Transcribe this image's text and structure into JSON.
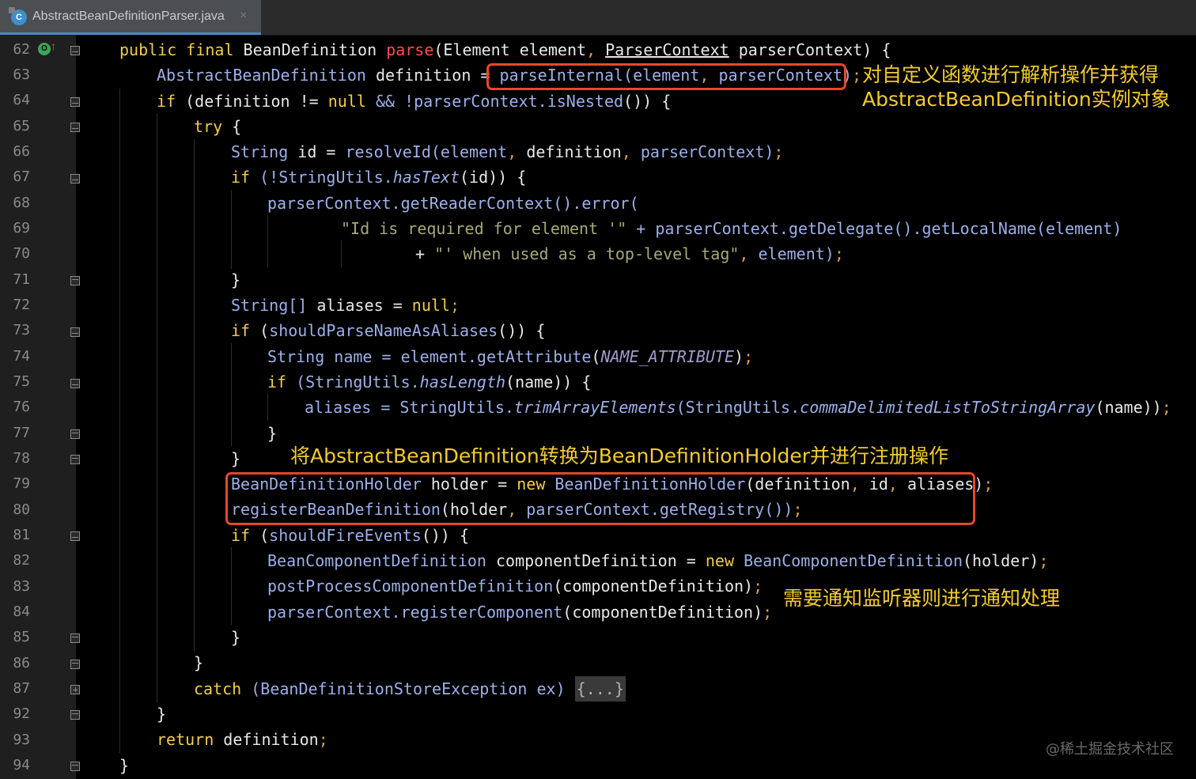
{
  "tab": {
    "title": "AbstractBeanDefinitionParser.java",
    "icon_letter": "C",
    "close_glyph": "×"
  },
  "gutter": {
    "line_numbers": [
      "62",
      "63",
      "64",
      "65",
      "66",
      "67",
      "68",
      "69",
      "70",
      "71",
      "72",
      "73",
      "74",
      "75",
      "76",
      "77",
      "78",
      "79",
      "80",
      "81",
      "82",
      "83",
      "84",
      "85",
      "86",
      "87",
      "92",
      "93",
      "94"
    ],
    "override_letter": "O",
    "override_arrow": "↑"
  },
  "code": {
    "l62": [
      "public final ",
      "BeanDefinition ",
      "parse",
      "(Element element",
      ", ",
      "ParserContext",
      " parserContext) {"
    ],
    "l63": [
      "AbstractBeanDefinition ",
      "definition = ",
      "parseInternal(element",
      ", ",
      "parserContext)",
      ";"
    ],
    "l64": [
      "if ",
      "(definition != ",
      "null ",
      "&& !parserContext.",
      "isNested",
      "()) {"
    ],
    "l65": [
      "try ",
      "{"
    ],
    "l66": [
      "String ",
      "id = ",
      "resolveId",
      "(element",
      ", ",
      "definition",
      ", ",
      "parserContext)",
      ";"
    ],
    "l67": [
      "if ",
      "(!StringUtils.",
      "hasText",
      "(id)) {"
    ],
    "l68": [
      "parserContext.",
      "getReaderContext",
      "().",
      "error",
      "("
    ],
    "l69": [
      "\"Id is required for element '\" ",
      "+ parserContext.",
      "getDelegate",
      "().",
      "getLocalName",
      "(element)"
    ],
    "l70": [
      "+ ",
      "\"' when used as a top-level tag\"",
      ", ",
      "element)",
      ";"
    ],
    "l71": [
      "}"
    ],
    "l72": [
      "String[] ",
      "aliases = ",
      "null",
      ";"
    ],
    "l73": [
      "if ",
      "(",
      "shouldParseNameAsAliases",
      "()) {"
    ],
    "l74": [
      "String ",
      "name = element.",
      "getAttribute",
      "(",
      "NAME_ATTRIBUTE",
      ")",
      ";"
    ],
    "l75": [
      "if ",
      "(StringUtils.",
      "hasLength",
      "(name)) {"
    ],
    "l76": [
      "aliases = StringUtils.",
      "trimArrayElements",
      "(StringUtils.",
      "commaDelimitedListToStringArray",
      "(name))",
      ";"
    ],
    "l77": [
      "}"
    ],
    "l78": [
      "}"
    ],
    "l79": [
      "BeanDefinitionHolder ",
      "holder = ",
      "new ",
      "BeanDefinitionHolder",
      "(definition",
      ", ",
      "id",
      ", ",
      "aliases)",
      ";"
    ],
    "l80": [
      "registerBeanDefinition",
      "(holder",
      ", ",
      "parserContext.",
      "getRegistry",
      "())",
      ";"
    ],
    "l81": [
      "if ",
      "(",
      "shouldFireEvents",
      "()) {"
    ],
    "l82": [
      "BeanComponentDefinition ",
      "componentDefinition = ",
      "new ",
      "BeanComponentDefinition",
      "(holder)",
      ";"
    ],
    "l83": [
      "postProcessComponentDefinition",
      "(componentDefinition)",
      ";"
    ],
    "l84": [
      "parserContext.",
      "registerComponent",
      "(componentDefinition)",
      ";"
    ],
    "l85": [
      "}"
    ],
    "l86": [
      "}"
    ],
    "l87": [
      "catch ",
      "(BeanDefinitionStoreException ex) ",
      "{...}"
    ],
    "l92": [
      "}"
    ],
    "l93": [
      "return ",
      "definition",
      ";"
    ],
    "l94": [
      "}"
    ]
  },
  "annotations": {
    "a1_line1": "对自定义函数进行解析操作并获得",
    "a1_line2": "AbstractBeanDefinition实例对象",
    "a2": "将AbstractBeanDefinition转换为BeanDefinitionHolder并进行注册操作",
    "a3": "需要通知监听器则进行通知处理"
  },
  "watermark": "@稀土掘金技术社区",
  "colors": {
    "keyword": "#f2cc4e",
    "type": "#9db0e8",
    "string": "#a8a87a",
    "highlight_box": "#e8472c",
    "annotation": "#f2cc2e"
  }
}
